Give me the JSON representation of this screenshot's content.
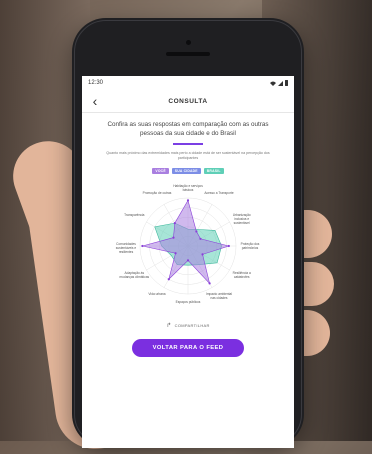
{
  "status_bar": {
    "time": "12:30"
  },
  "nav": {
    "back_icon": "chevron-left-icon",
    "title": "CONSULTA"
  },
  "headline": "Confira as suas respostas em comparação com as outras pessoas da sua cidade e do Brasil",
  "subtext": "Quanto mais próximo das extremidades mais perto a cidade está de ser sustentável na percepção dos participantes",
  "legend": [
    {
      "label": "VOCÊ",
      "color": "#a97fe0"
    },
    {
      "label": "SUA CIDADE",
      "color": "#7d8ee6"
    },
    {
      "label": "BRASIL",
      "color": "#5fcfb7"
    }
  ],
  "chart_data": {
    "type": "radar",
    "axes": [
      "Habitação e serviços básicos",
      "Acesso a Transporte",
      "Urbanização inclusiva e sustentável",
      "Proteção dos patrimônios",
      "Resiliência a catástrofes",
      "Impacto ambiental nas cidades",
      "Espaços públicos",
      "Vida urbana",
      "Adaptação às mudanças climáticas",
      "Comunidades sustentáveis e resilientes",
      "Transparência",
      "Promoção de outras"
    ],
    "series": [
      {
        "name": "VOCÊ",
        "values": [
          0.95,
          0.35,
          0.3,
          0.85,
          0.35,
          0.9,
          0.3,
          0.8,
          0.3,
          0.95,
          0.35,
          0.55
        ]
      },
      {
        "name": "BRASIL",
        "values": [
          0.35,
          0.4,
          0.65,
          0.7,
          0.7,
          0.45,
          0.4,
          0.45,
          0.4,
          0.55,
          0.8,
          0.55
        ]
      }
    ],
    "colors": {
      "voce": "#a97fe0",
      "brasil": "#5fcfb7",
      "point": "#8a3fd9"
    }
  },
  "share": {
    "icon": "share-arrow-icon",
    "label": "COMPARTILHAR"
  },
  "feed_button": {
    "label": "VOLTAR PARA O FEED"
  }
}
